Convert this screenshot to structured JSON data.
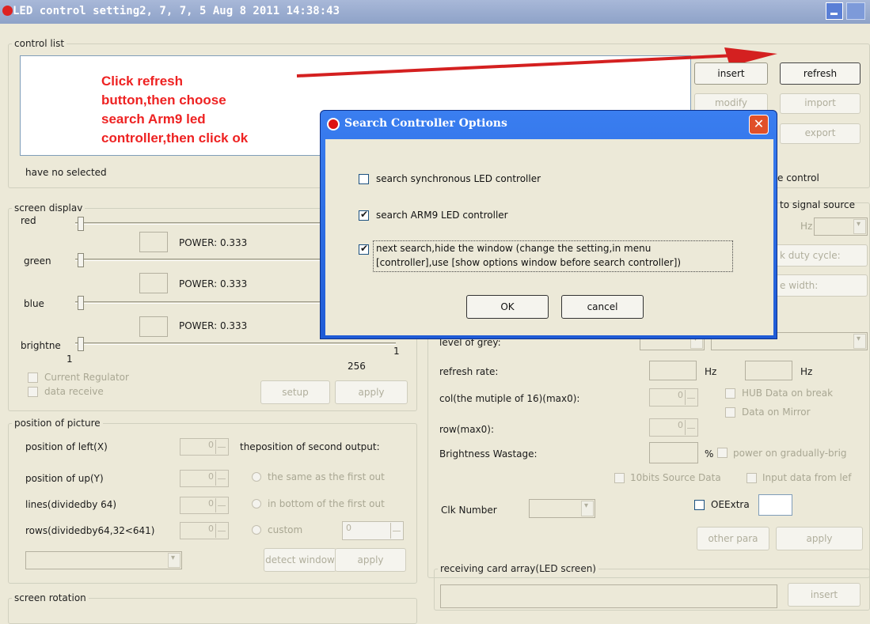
{
  "window": {
    "title": "LED control setting2, 7, 7, 5  Aug  8 2011  14:38:43"
  },
  "control_list": {
    "legend": "control list",
    "instruction_lines": [
      "Click refresh",
      "button,then choose",
      "search Arm9 led",
      "controller,then click ok"
    ],
    "status": "have no selected",
    "buttons": {
      "insert": "insert",
      "refresh": "refresh",
      "modify": "modify",
      "import": "import",
      "export": "export"
    },
    "right_label_partial": "e control"
  },
  "screen_display": {
    "legend": "screen displav",
    "red_label": "red",
    "green_label": "green",
    "blue_label": "blue",
    "brightness_label": "brightne",
    "power_red": "POWER: 0.333",
    "power_green": "POWER: 0.333",
    "power_blue": "POWER: 0.333",
    "scale_min": "1",
    "scale_max": "256",
    "scale_right": "1",
    "current_regulator": "Current Regulator",
    "data_receive": "data receive",
    "setup": "setup",
    "apply": "apply"
  },
  "position_of_picture": {
    "legend": "position of picture",
    "left_label": "position of left(X)",
    "up_label": "position of up(Y)",
    "lines_label": "lines(dividedby 64)",
    "rows_label": "rows(dividedby64,32<641)",
    "second_output_label": "theposition of second output:",
    "opt_same": "the same as the first out",
    "opt_bottom": "in bottom of the first out",
    "opt_custom": "custom",
    "spin_value": "0",
    "custom_value": "0",
    "detect_window": "detect window",
    "apply": "apply"
  },
  "screen_rotation": {
    "legend": "screen rotation"
  },
  "right_panel": {
    "signal_source_partial": "to signal source",
    "hz_partial": "Hz",
    "duty_cycle_partial": "k duty cycle:",
    "width_partial": "e width:",
    "level_of_grey": "level of grey:",
    "refresh_rate": "refresh rate:",
    "hz1": "Hz",
    "hz2": "Hz",
    "col_label": "col(the mutiple of 16)(max0):",
    "row_label": "row(max0):",
    "hub_data": "HUB Data on break",
    "data_mirror": "Data on Mirror",
    "brightness_wastage": "Brightness Wastage:",
    "percent": "%",
    "power_on_gradually": "power on gradually-brig",
    "bits10": "10bits Source Data",
    "input_from_left": "Input data from lef",
    "clk_number": "Clk Number",
    "oe_extra": "OEExtra",
    "other_para": "other para",
    "apply": "apply",
    "spin_value": "0"
  },
  "receiving_card": {
    "legend": "receiving card array(LED screen)",
    "insert": "insert"
  },
  "dialog": {
    "title": "Search Controller Options",
    "opt1": "search synchronous LED controller",
    "opt2": "search ARM9 LED controller",
    "opt3_line1": "next search,hide the window (change the setting,in menu",
    "opt3_line2": "[controller],use [show options window before search controller])",
    "ok": "OK",
    "cancel": "cancel",
    "opt1_checked": false,
    "opt2_checked": true,
    "opt3_checked": true
  },
  "colors": {
    "annotation_red": "#ee2222",
    "dialog_blue": "#1f5bd6"
  }
}
